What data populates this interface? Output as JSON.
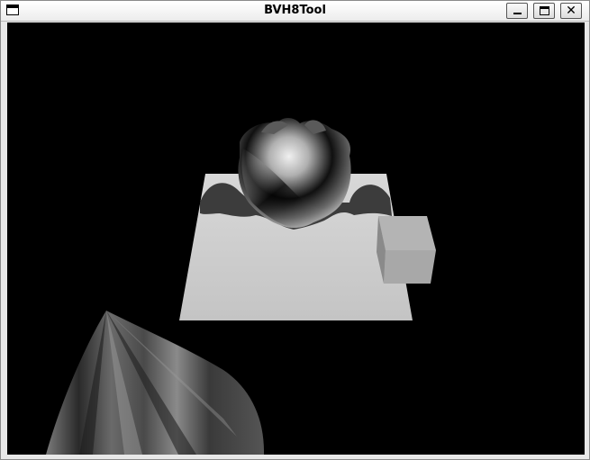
{
  "window": {
    "title": "BVH8Tool",
    "controls": {
      "minimize_icon": "minimize-icon",
      "maximize_icon": "maximize-icon",
      "close_icon": "close-icon",
      "close_glyph": "✕"
    }
  },
  "viewport": {
    "background": "#000000",
    "scene": [
      "sphere",
      "plane",
      "cube",
      "cone"
    ]
  }
}
